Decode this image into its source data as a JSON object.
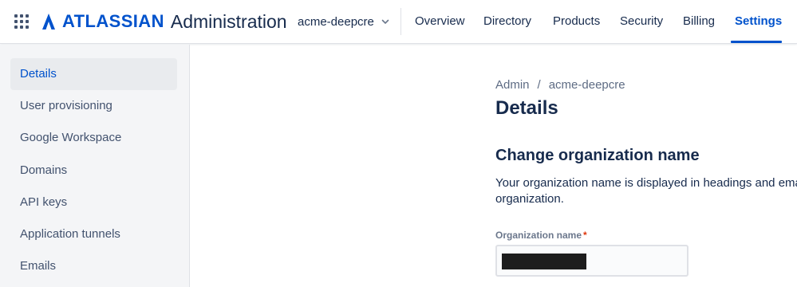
{
  "header": {
    "brand_word": "ATLASSIAN",
    "product": "Administration",
    "brand_color": "#0052cc",
    "org_switcher": {
      "label": "acme-deepcre",
      "icon": "chevron-down-icon"
    },
    "nav": [
      {
        "label": "Overview",
        "active": false
      },
      {
        "label": "Directory",
        "active": false
      },
      {
        "label": "Products",
        "active": false
      },
      {
        "label": "Security",
        "active": false
      },
      {
        "label": "Billing",
        "active": false
      },
      {
        "label": "Settings",
        "active": true
      }
    ]
  },
  "sidebar": {
    "items": [
      {
        "label": "Details",
        "active": true
      },
      {
        "label": "User provisioning",
        "active": false
      },
      {
        "label": "Google Workspace",
        "active": false
      },
      {
        "label": "Domains",
        "active": false
      },
      {
        "label": "API keys",
        "active": false
      },
      {
        "label": "Application tunnels",
        "active": false
      },
      {
        "label": "Emails",
        "active": false
      }
    ]
  },
  "main": {
    "breadcrumb": [
      "Admin",
      "acme-deepcre"
    ],
    "breadcrumb_separator": "/",
    "title": "Details",
    "section": {
      "title": "Change organization name",
      "description": "Your organization name is displayed in headings and email organization.",
      "field_label": "Organization name",
      "required_marker": "*"
    }
  }
}
